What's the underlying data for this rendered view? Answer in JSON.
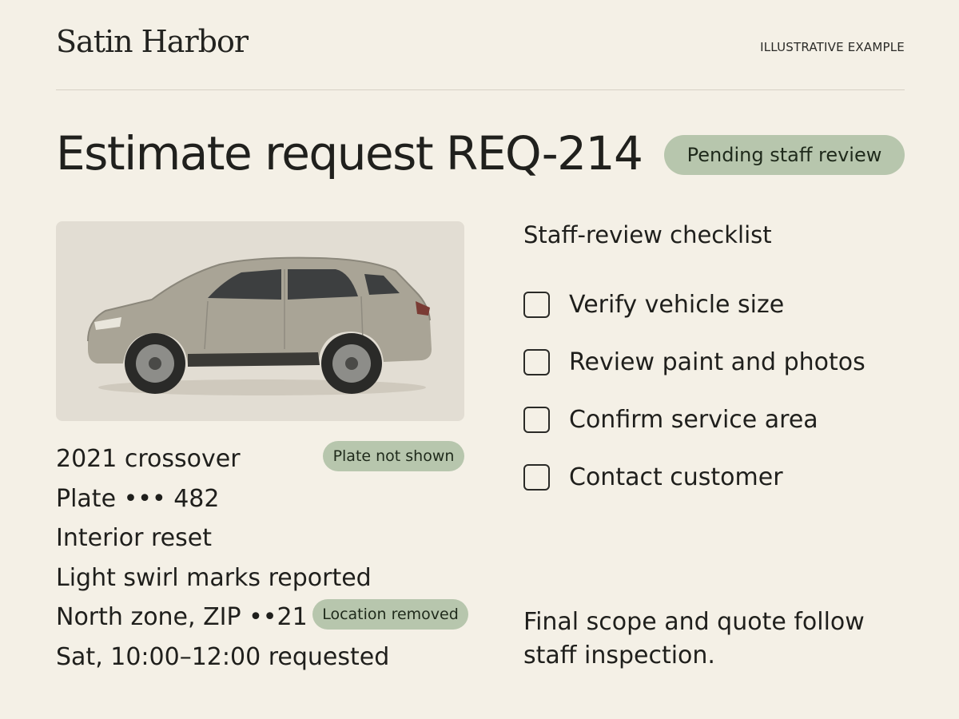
{
  "header": {
    "brand": "Satin Harbor",
    "tag": "ILLUSTRATIVE EXAMPLE"
  },
  "request": {
    "title": "Estimate request REQ-214",
    "status": "Pending staff review"
  },
  "vehicle": {
    "photo_icon": "crossover-vehicle-photo",
    "model": "2021 crossover",
    "plate_badge": "Plate not shown",
    "plate": "Plate ••• 482",
    "service": "Interior reset",
    "note": "Light swirl marks reported",
    "location": "North zone, ZIP ••21",
    "location_badge": "Location removed",
    "schedule": "Sat, 10:00–12:00 requested"
  },
  "checklist": {
    "title": "Staff-review checklist",
    "items": [
      {
        "label": "Verify vehicle size",
        "checked": false
      },
      {
        "label": "Review paint and photos",
        "checked": false
      },
      {
        "label": "Confirm service area",
        "checked": false
      },
      {
        "label": "Contact customer",
        "checked": false
      }
    ]
  },
  "footnote": {
    "line1": "Final scope and quote follow",
    "line2": "staff inspection."
  },
  "colors": {
    "background": "#f4f0e6",
    "badge": "#b7c6ad",
    "photo_background": "#e2ddd3"
  }
}
